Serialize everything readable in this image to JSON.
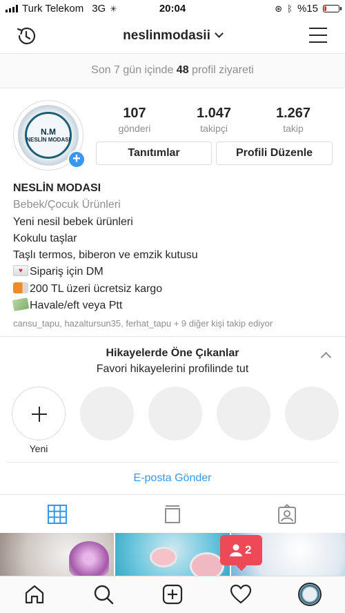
{
  "status_bar": {
    "carrier": "Turk Telekom",
    "network": "3G",
    "time": "20:04",
    "battery_text": "%15",
    "battery_level": 0.15,
    "icons": [
      "signal-bars-icon",
      "loading-icon",
      "orientation-lock-icon",
      "bluetooth-icon",
      "battery-icon"
    ]
  },
  "header": {
    "username": "neslinmodasii",
    "left_icon": "history-icon",
    "right_icon": "menu-icon"
  },
  "visits": {
    "prefix": "Son 7 gün içinde",
    "count": "48",
    "suffix": "profil ziyareti"
  },
  "profile": {
    "logo_line1": "N.M",
    "logo_line2": "NESLİN MODASI",
    "stats": [
      {
        "value": "107",
        "label": "gönderi"
      },
      {
        "value": "1.047",
        "label": "takipçi"
      },
      {
        "value": "1.267",
        "label": "takip"
      }
    ],
    "buttons": {
      "promotions": "Tanıtımlar",
      "edit_profile": "Profili Düzenle"
    }
  },
  "bio": {
    "name": "NESLİN MODASI",
    "category": "Bebek/Çocuk Ürünleri",
    "lines": [
      "Yeni nesil bebek ürünleri",
      "Kokulu taşlar",
      "Taşlı termos, biberon ve emzik kutusu",
      "Sipariş için DM",
      "200 TL üzeri ücretsiz kargo",
      "Havale/eft veya Ptt"
    ],
    "followed_by": "cansu_tapu, hazaltursun35, ferhat_tapu + 9 diğer kişi takip ediyor"
  },
  "highlights": {
    "title": "Hikayelerde Öne Çıkanlar",
    "subtitle": "Favori hikayelerini profilinde tut",
    "new_label": "Yeni"
  },
  "email_button": "E-posta Gönder",
  "notification": {
    "count": "2"
  },
  "colors": {
    "accent": "#3897f0",
    "notification": "#ed4956",
    "muted": "#8e8e8e"
  }
}
